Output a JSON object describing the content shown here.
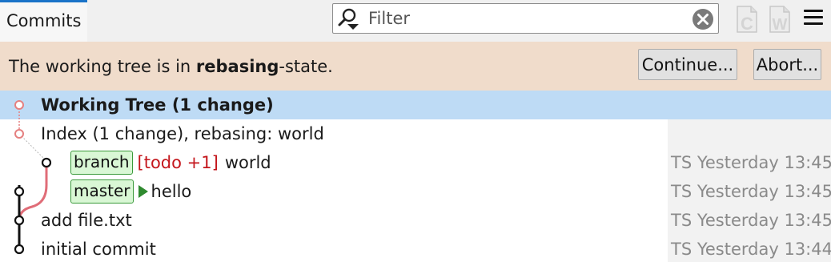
{
  "tab": {
    "label": "Commits"
  },
  "filter": {
    "placeholder": "Filter"
  },
  "toolbar": {
    "filter_icon": "search-dropdown-icon",
    "clear_icon": "clear-circle-icon",
    "tool_c_icon": "committer-filter-icon",
    "tool_w_icon": "workspace-filter-icon",
    "menu_icon": "hamburger-menu-icon",
    "tool_c_letter": "C",
    "tool_w_letter": "W"
  },
  "banner": {
    "prefix": "The working tree is in ",
    "state": "rebasing",
    "suffix": "-state.",
    "continue_label": "Continue...",
    "abort_label": "Abort...",
    "background": "#f0dccb"
  },
  "commits": [
    {
      "message": "Working Tree (1 change)",
      "meta": "",
      "selected": true
    },
    {
      "message": "Index (1 change), rebasing: world",
      "meta": ""
    },
    {
      "branch": "branch",
      "todo": "[todo +1]",
      "message": "world",
      "meta": "TS Yesterday 13:45"
    },
    {
      "branch": "master",
      "head": true,
      "message": "hello",
      "meta": "TS Yesterday 13:45"
    },
    {
      "message": "add file.txt",
      "meta": "TS Yesterday 13:45"
    },
    {
      "message": "initial commit",
      "meta": "TS Yesterday 13:44"
    }
  ],
  "colors": {
    "accent": "#1a73c8",
    "selection": "#bedbf5",
    "branch_chip": "#d9f7d5",
    "todo": "#c4161c",
    "graph_pending": "#e58080",
    "graph_main": "#111111",
    "head_marker": "#2f8a2f"
  }
}
